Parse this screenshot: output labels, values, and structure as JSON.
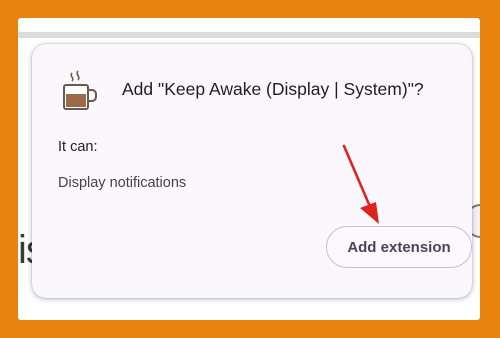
{
  "page": {
    "background_partial_text": "is"
  },
  "dialog": {
    "title": "Add \"Keep Awake (Display | System)\"?",
    "icon": "coffee-cup-icon",
    "it_can_label": "It can:",
    "permissions": [
      "Display notifications"
    ],
    "add_button_label": "Add extension"
  },
  "colors": {
    "border_frame": "#e8830e",
    "annotation_arrow": "#e0241c"
  }
}
